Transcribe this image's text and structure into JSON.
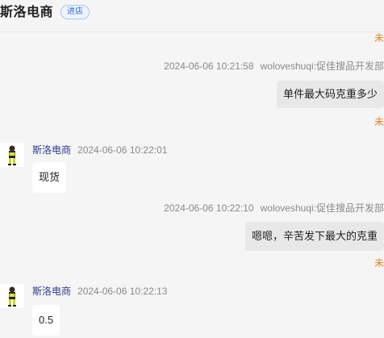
{
  "header": {
    "shop_name": "斯洛电商",
    "enter_label": "进店"
  },
  "messages": [
    {
      "side": "right",
      "status": "未",
      "time": "2024-06-06 10:21:58",
      "sender": "woloveshuqi:促佳搜品开发部",
      "text": "单件最大码克重多少",
      "read_status": "未"
    },
    {
      "side": "left",
      "sender": "斯洛电商",
      "time": "2024-06-06 10:22:01",
      "text": "现货",
      "avatar_icon": "shop-avatar-icon"
    },
    {
      "side": "right",
      "time": "2024-06-06 10:22:10",
      "sender": "woloveshuqi:促佳搜品开发部",
      "text": "嗯嗯，辛苦发下最大的克重",
      "read_status": "未"
    },
    {
      "side": "left",
      "sender": "斯洛电商",
      "time": "2024-06-06 10:22:13",
      "text": "0.5",
      "avatar_icon": "shop-avatar-icon"
    }
  ]
}
